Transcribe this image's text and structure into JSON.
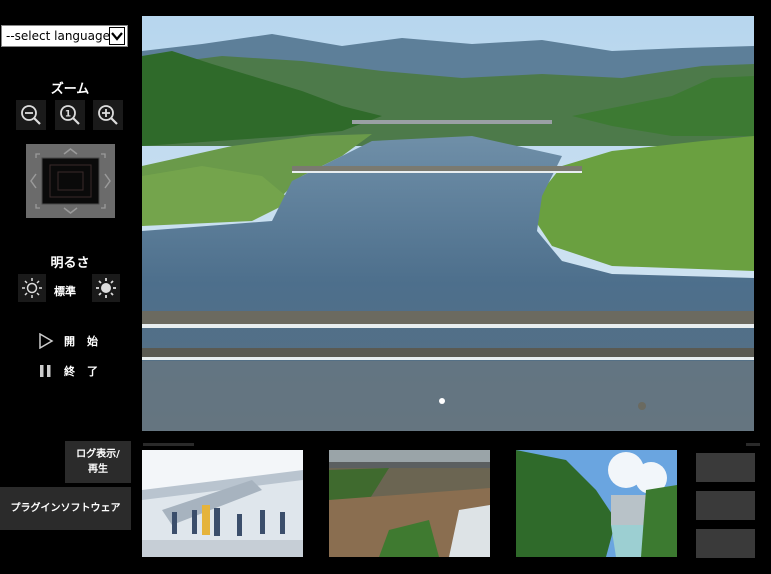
{
  "language_select": {
    "value": "--select language--"
  },
  "zoom": {
    "title": "ズーム",
    "buttons": [
      {
        "name": "zoom-out-icon"
      },
      {
        "name": "zoom-reset-icon"
      },
      {
        "name": "zoom-in-icon"
      }
    ]
  },
  "brightness": {
    "title": "明るさ",
    "standard_label": "標準"
  },
  "playback": {
    "start_label": "開始",
    "stop_label": "終了"
  },
  "buttons": {
    "log_play": "ログ表示/再生",
    "plugin_software": "プラグインソフトウェア"
  },
  "colors": {
    "background": "#000000",
    "panel_button": "#2b2b2b",
    "icon_button": "#1a1a1a",
    "ptz_pad": "#6b6b6b"
  }
}
